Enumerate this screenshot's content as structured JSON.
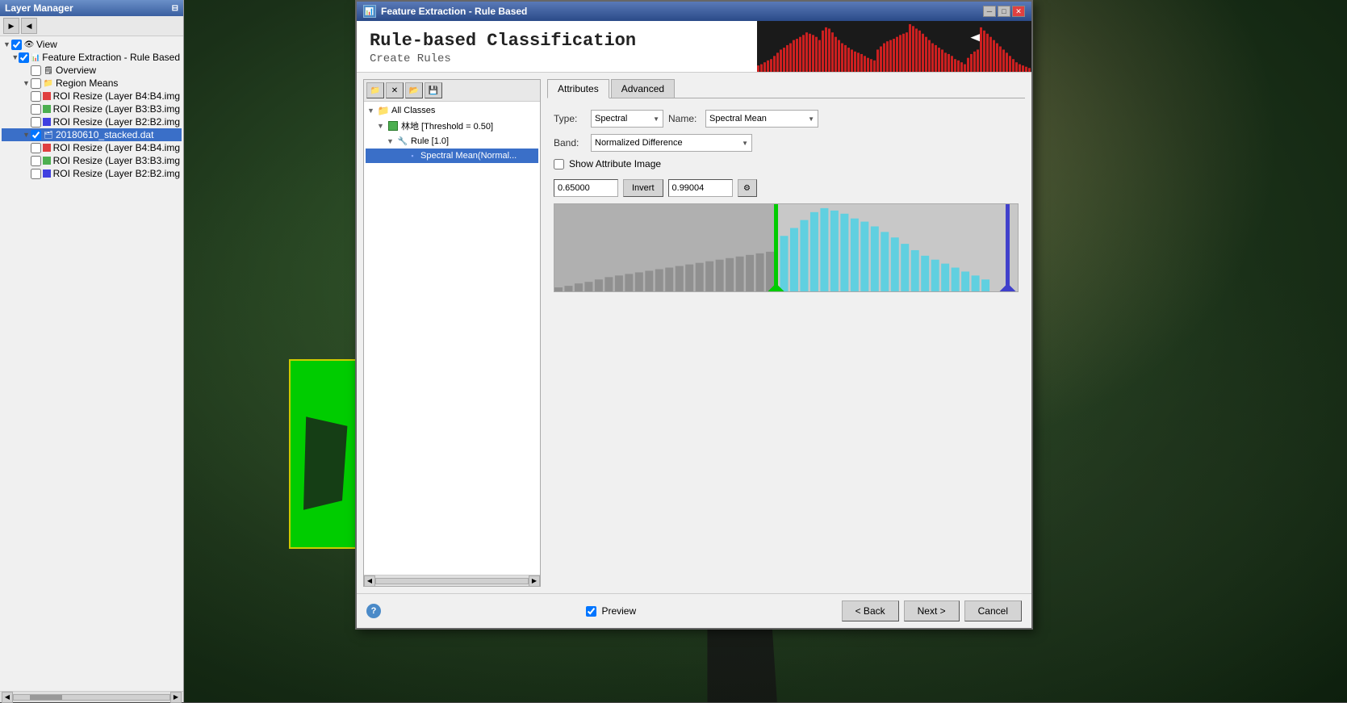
{
  "layer_manager": {
    "title": "Layer Manager",
    "title_icon": "⊞",
    "toolbar": {
      "btn1": "▶",
      "btn2": "◀"
    },
    "tree": [
      {
        "id": "view",
        "label": "View",
        "indent": 0,
        "arrow": "▼",
        "icon": "view",
        "checked": true
      },
      {
        "id": "feature_extraction",
        "label": "Feature Extraction - Rule Based",
        "indent": 1,
        "arrow": "▼",
        "icon": "layer",
        "checked": true
      },
      {
        "id": "overview",
        "label": "Overview",
        "indent": 2,
        "arrow": "",
        "icon": "small",
        "checked": false
      },
      {
        "id": "region_means",
        "label": "Region Means",
        "indent": 2,
        "arrow": "▼",
        "icon": "folder",
        "checked": false
      },
      {
        "id": "roi1",
        "label": "ROI Resize (Layer B4:B4.img",
        "indent": 3,
        "arrow": "",
        "icon": "red",
        "checked": false
      },
      {
        "id": "roi2",
        "label": "ROI Resize (Layer B3:B3.img",
        "indent": 3,
        "arrow": "",
        "icon": "green",
        "checked": false
      },
      {
        "id": "roi3",
        "label": "ROI Resize (Layer B2:B2.img",
        "indent": 3,
        "arrow": "",
        "icon": "blue",
        "checked": false
      },
      {
        "id": "stacked",
        "label": "20180610_stacked.dat",
        "indent": 2,
        "arrow": "▼",
        "icon": "layer_checked",
        "checked": true,
        "selected": true
      },
      {
        "id": "roi4",
        "label": "ROI Resize (Layer B4:B4.img",
        "indent": 3,
        "arrow": "",
        "icon": "red",
        "checked": false
      },
      {
        "id": "roi5",
        "label": "ROI Resize (Layer B3:B3.img",
        "indent": 3,
        "arrow": "",
        "icon": "green",
        "checked": false
      },
      {
        "id": "roi6",
        "label": "ROI Resize (Layer B2:B2.img",
        "indent": 3,
        "arrow": "",
        "icon": "blue",
        "checked": false
      }
    ]
  },
  "dialog": {
    "title": "Feature Extraction - Rule Based",
    "title_icon": "📊",
    "header": {
      "title": "Rule-based Classification",
      "subtitle": "Create Rules"
    },
    "window_controls": {
      "minimize": "─",
      "restore": "□",
      "close": "✕"
    }
  },
  "rules_toolbar": {
    "btn_open_folder": "📁",
    "btn_close": "✕",
    "btn_open": "📂",
    "btn_save": "💾"
  },
  "rules_tree": [
    {
      "id": "all_classes",
      "label": "All Classes",
      "indent": 0,
      "arrow": "▼",
      "icon": "folder",
      "selected": false
    },
    {
      "id": "lindi",
      "label": "林地 [Threshold = 0.50]",
      "indent": 1,
      "arrow": "▼",
      "icon": "green_class",
      "selected": false
    },
    {
      "id": "rule1",
      "label": "Rule [1.0]",
      "indent": 2,
      "arrow": "▼",
      "icon": "rule",
      "selected": false
    },
    {
      "id": "spectral_mean",
      "label": "Spectral Mean(Normal...",
      "indent": 3,
      "arrow": "",
      "icon": "attribute",
      "selected": true
    }
  ],
  "attributes": {
    "tabs": [
      "Attributes",
      "Advanced"
    ],
    "active_tab": "Attributes",
    "type_label": "Type:",
    "type_value": "Spectral",
    "name_label": "Name:",
    "name_value": "Spectral Mean",
    "band_label": "Band:",
    "band_value": "Normalized Difference",
    "show_attr_label": "Show Attribute Image",
    "show_attr_checked": false,
    "min_value": "0.65000",
    "max_value": "0.99004",
    "invert_label": "Invert"
  },
  "footer": {
    "preview_label": "Preview",
    "preview_checked": true,
    "back_label": "< Back",
    "next_label": "Next >",
    "cancel_label": "Cancel",
    "help_label": "?"
  }
}
